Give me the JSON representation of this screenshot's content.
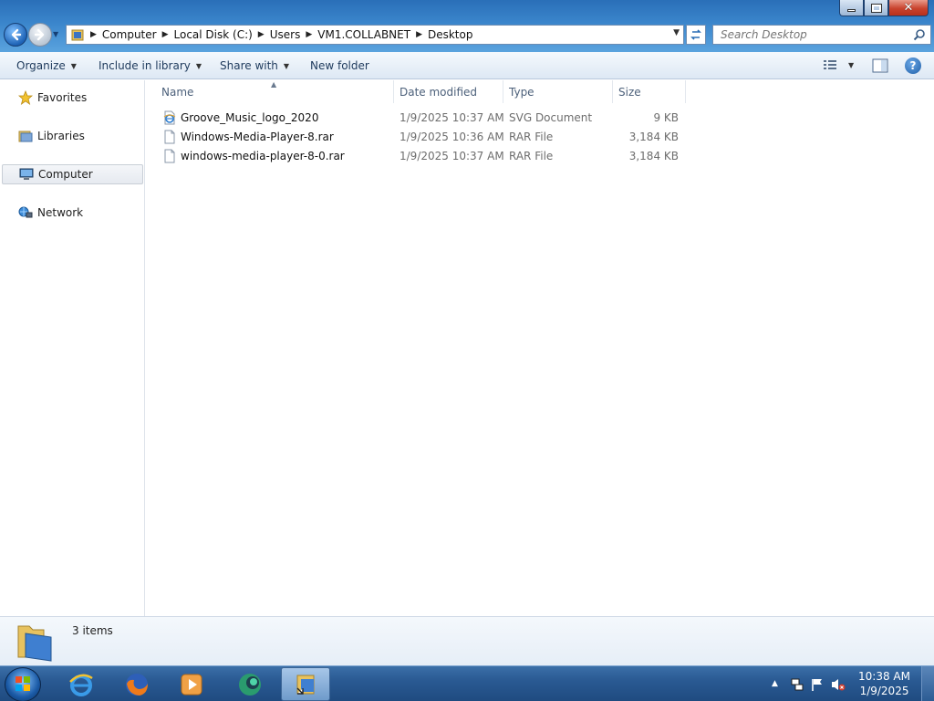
{
  "window": {
    "caption_buttons": [
      "minimize",
      "maximize",
      "close"
    ]
  },
  "address_bar": {
    "crumbs": [
      "Computer",
      "Local Disk (C:)",
      "Users",
      "VM1.COLLABNET",
      "Desktop"
    ]
  },
  "search": {
    "placeholder": "Search Desktop"
  },
  "toolbar": {
    "organize": "Organize",
    "include_in_library": "Include in library",
    "share_with": "Share with",
    "new_folder": "New folder"
  },
  "nav_pane": {
    "items": [
      {
        "label": "Favorites",
        "icon": "star-icon"
      },
      {
        "label": "Libraries",
        "icon": "libraries-icon"
      },
      {
        "label": "Computer",
        "icon": "computer-icon",
        "selected": true
      },
      {
        "label": "Network",
        "icon": "network-icon"
      }
    ]
  },
  "file_list": {
    "columns": [
      "Name",
      "Date modified",
      "Type",
      "Size"
    ],
    "rows": [
      {
        "name": "Groove_Music_logo_2020",
        "date": "1/9/2025 10:37 AM",
        "type": "SVG Document",
        "size": "9 KB",
        "icon": "ie-document-icon"
      },
      {
        "name": "Windows-Media-Player-8.rar",
        "date": "1/9/2025 10:36 AM",
        "type": "RAR File",
        "size": "3,184 KB",
        "icon": "blank-file-icon"
      },
      {
        "name": "windows-media-player-8-0.rar",
        "date": "1/9/2025 10:37 AM",
        "type": "RAR File",
        "size": "3,184 KB",
        "icon": "blank-file-icon"
      }
    ]
  },
  "details_pane": {
    "count_text": "3 items"
  },
  "taskbar": {
    "apps": [
      "start-orb",
      "internet-explorer",
      "firefox",
      "windows-media-player",
      "green-app",
      "file-explorer"
    ],
    "clock_time": "10:38 AM",
    "clock_date": "1/9/2025"
  },
  "colors": {
    "title_gradient_top": "#2a6fb8",
    "taskbar": "#2a5a93",
    "column_header_text": "#4c607a",
    "secondary_text": "#6d6d6d"
  }
}
